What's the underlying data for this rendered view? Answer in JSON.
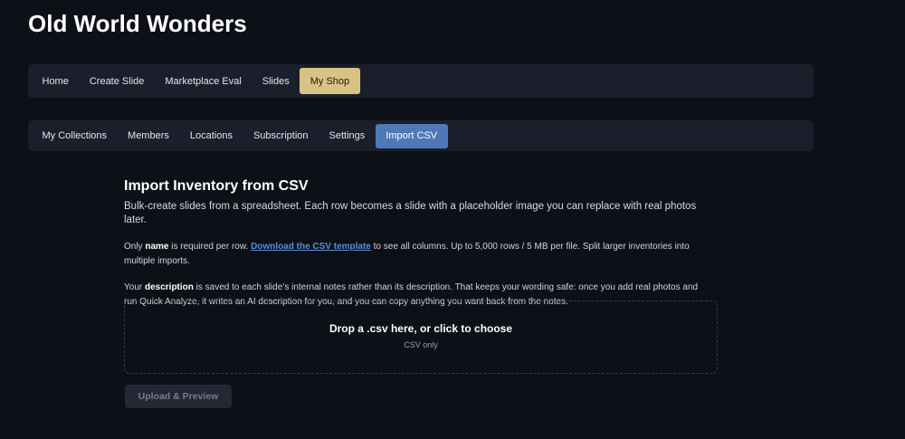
{
  "site": {
    "title": "Old World Wonders"
  },
  "main_nav": {
    "items": [
      {
        "label": "Home",
        "active": false
      },
      {
        "label": "Create Slide",
        "active": false
      },
      {
        "label": "Marketplace Eval",
        "active": false
      },
      {
        "label": "Slides",
        "active": false
      },
      {
        "label": "My Shop",
        "active": true
      }
    ],
    "active_color": "#d9c384"
  },
  "sub_nav": {
    "items": [
      {
        "label": "My Collections",
        "active": false
      },
      {
        "label": "Members",
        "active": false
      },
      {
        "label": "Locations",
        "active": false
      },
      {
        "label": "Subscription",
        "active": false
      },
      {
        "label": "Settings",
        "active": false
      },
      {
        "label": "Import CSV",
        "active": true
      }
    ],
    "active_color": "#4f78b8"
  },
  "import": {
    "heading": "Import Inventory from CSV",
    "subtitle": "Bulk-create slides from a spreadsheet. Each row becomes a slide with a placeholder image you can replace with real photos later.",
    "para1": {
      "prefix": "Only ",
      "bold": "name",
      "middle": " is required per row. ",
      "link": "Download the CSV template",
      "suffix": " to see all columns. Up to 5,000 rows / 5 MB per file. Split larger inventories into multiple imports."
    },
    "para2": {
      "prefix": "Your ",
      "bold": "description",
      "suffix": " is saved to each slide’s internal notes rather than its description. That keeps your wording safe: once you add real photos and run Quick Analyze, it writes an AI description for you, and you can copy anything you want back from the notes."
    },
    "drop_zone": {
      "title": "Drop a .csv here, or click to choose",
      "hint": "CSV only"
    },
    "upload_button": {
      "label": "Upload & Preview",
      "disabled": true
    }
  }
}
